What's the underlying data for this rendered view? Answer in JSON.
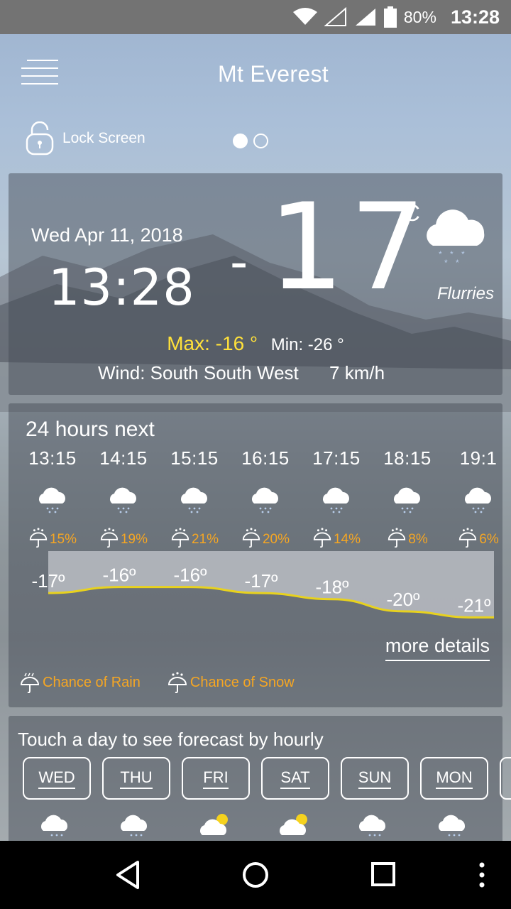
{
  "status_bar": {
    "battery": "80%",
    "time": "13:28"
  },
  "header": {
    "city": "Mt Everest",
    "lock_label": "Lock Screen"
  },
  "current": {
    "date": "Wed Apr 11, 2018",
    "time": "13:28",
    "temp_sign": "-",
    "temp": "17",
    "unit": "°C",
    "condition": "Flurries",
    "max": "Max: -16 °",
    "min": "Min: -26 °",
    "wind_label": "Wind: South South West",
    "wind_speed": "7 km/h"
  },
  "hourly": {
    "title": "24 hours next",
    "hours": [
      {
        "time": "13:15",
        "pop": "15%",
        "temp": "-17º",
        "temp_value": -17
      },
      {
        "time": "14:15",
        "pop": "19%",
        "temp": "-16º",
        "temp_value": -16
      },
      {
        "time": "15:15",
        "pop": "21%",
        "temp": "-16º",
        "temp_value": -16
      },
      {
        "time": "16:15",
        "pop": "20%",
        "temp": "-17º",
        "temp_value": -17
      },
      {
        "time": "17:15",
        "pop": "14%",
        "temp": "-18º",
        "temp_value": -18
      },
      {
        "time": "18:15",
        "pop": "8%",
        "temp": "-20º",
        "temp_value": -20
      },
      {
        "time": "19:1",
        "pop": "6%",
        "temp": "-21º",
        "temp_value": -21
      }
    ],
    "more_details": "more details",
    "legend_rain": "Chance of Rain",
    "legend_snow": "Chance of Snow"
  },
  "daily": {
    "title": "Touch a day to see forecast by hourly",
    "days": [
      "WED",
      "THU",
      "FRI",
      "SAT",
      "SUN",
      "MON"
    ]
  },
  "colors": {
    "accent": "#f5a623",
    "max": "#ffe13a",
    "line": "#e8d21e"
  }
}
